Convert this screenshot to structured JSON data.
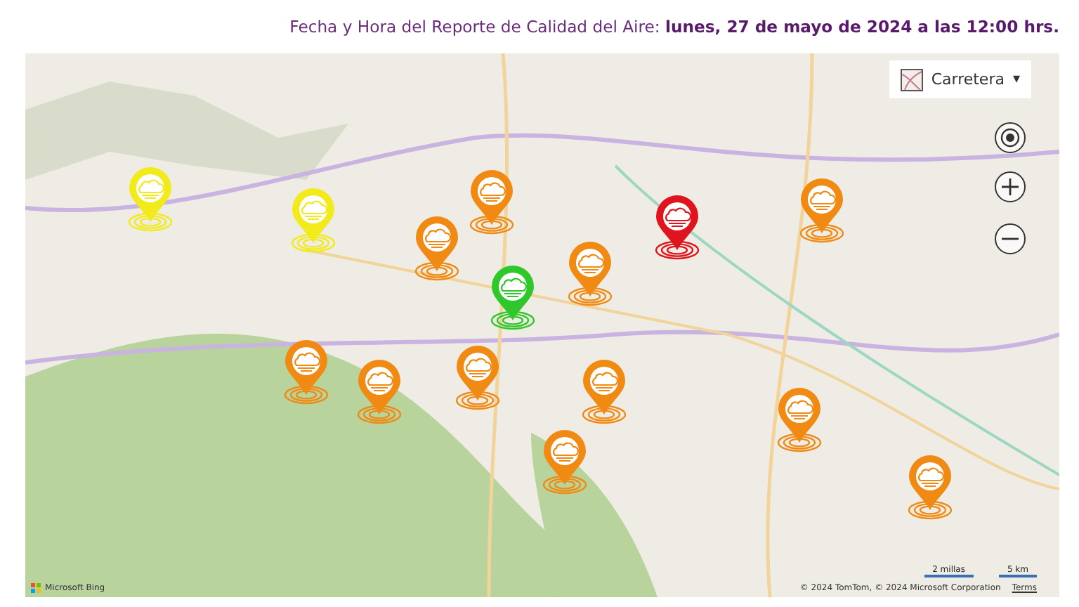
{
  "header": {
    "text": "Fecha y Hora del Reporte de Calidad del Aire: **lunes, 27 de mayo de 2024 a las 12:00 hrs.**"
  },
  "map": {
    "style_selector": {
      "label": "Carretera",
      "caret": "▾"
    },
    "pins": [
      {
        "color": "#f2ea1a"
      },
      {
        "color": "#f2ea1a"
      },
      {
        "color": "#f08a12"
      },
      {
        "color": "#f08a12"
      },
      {
        "color": "#2fc72a"
      },
      {
        "color": "#f08a12"
      },
      {
        "color": "#e0141e"
      },
      {
        "color": "#f08a12"
      },
      {
        "color": "#f08a12"
      },
      {
        "color": "#f08a12"
      },
      {
        "color": "#f08a12"
      },
      {
        "color": "#f08a12"
      },
      {
        "color": "#f08a12"
      },
      {
        "color": "#f08a12"
      },
      {
        "color": "#f08a12"
      }
    ],
    "brand": "Microsoft Bing",
    "scale": [
      "2 millas",
      "5 km"
    ],
    "attribution": "© 2024 TomTom, © 2024 Microsoft Corporation",
    "terms": "Terms"
  }
}
